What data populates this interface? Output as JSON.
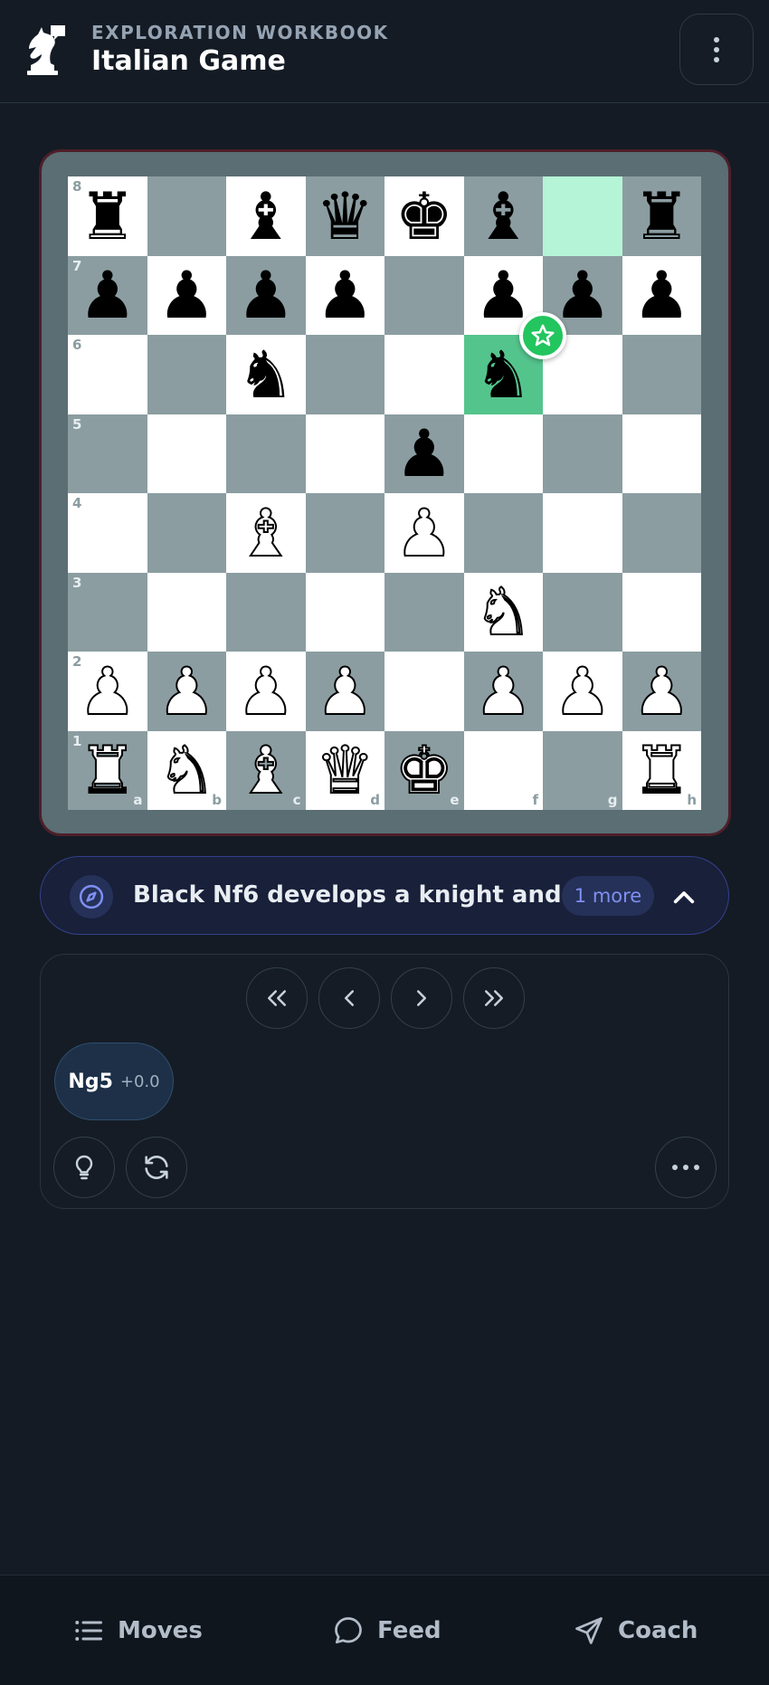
{
  "header": {
    "eyebrow": "EXPLORATION WORKBOOK",
    "title": "Italian Game",
    "logo_icon": "knight-chat-icon",
    "menu_icon": "kebab-vertical-icon"
  },
  "board": {
    "highlight_color_light": "#b5f4d6",
    "highlight_color_dark": "#54c48d",
    "last_move": {
      "from": "g8",
      "to": "f6"
    },
    "badge_icon": "star-icon",
    "ranks": [
      [
        "r",
        "",
        "b",
        "q",
        "k",
        "b",
        "",
        "r"
      ],
      [
        "p",
        "p",
        "p",
        "p",
        "",
        "p",
        "p",
        "p"
      ],
      [
        "",
        "",
        "n",
        "",
        "",
        "n",
        "",
        ""
      ],
      [
        "",
        "",
        "",
        "",
        "p",
        "",
        "",
        ""
      ],
      [
        "",
        "",
        "B",
        "",
        "P",
        "",
        "",
        ""
      ],
      [
        "",
        "",
        "",
        "",
        "",
        "N",
        "",
        ""
      ],
      [
        "P",
        "P",
        "P",
        "P",
        "",
        "P",
        "P",
        "P"
      ],
      [
        "R",
        "N",
        "B",
        "Q",
        "K",
        "",
        "",
        "R"
      ]
    ],
    "rank_labels": [
      "8",
      "7",
      "6",
      "5",
      "4",
      "3",
      "2",
      "1"
    ],
    "file_labels": [
      "a",
      "b",
      "c",
      "d",
      "e",
      "f",
      "g",
      "h"
    ]
  },
  "comment": {
    "icon": "compass-icon",
    "text": "Black Nf6 develops a knight and ...",
    "more_label": "1 more",
    "toggle_icon": "chevron-up-icon"
  },
  "controls": {
    "nav_icons": [
      "double-chevron-left-icon",
      "chevron-left-icon",
      "chevron-right-icon",
      "double-chevron-right-icon"
    ],
    "candidate_move": {
      "san": "Ng5",
      "eval": "+0.0"
    },
    "tools": [
      "lightbulb-icon",
      "refresh-icon"
    ],
    "more_icon": "ellipsis-icon"
  },
  "bottom_nav": {
    "moves_label": "Moves",
    "feed_label": "Feed",
    "coach_label": "Coach"
  }
}
